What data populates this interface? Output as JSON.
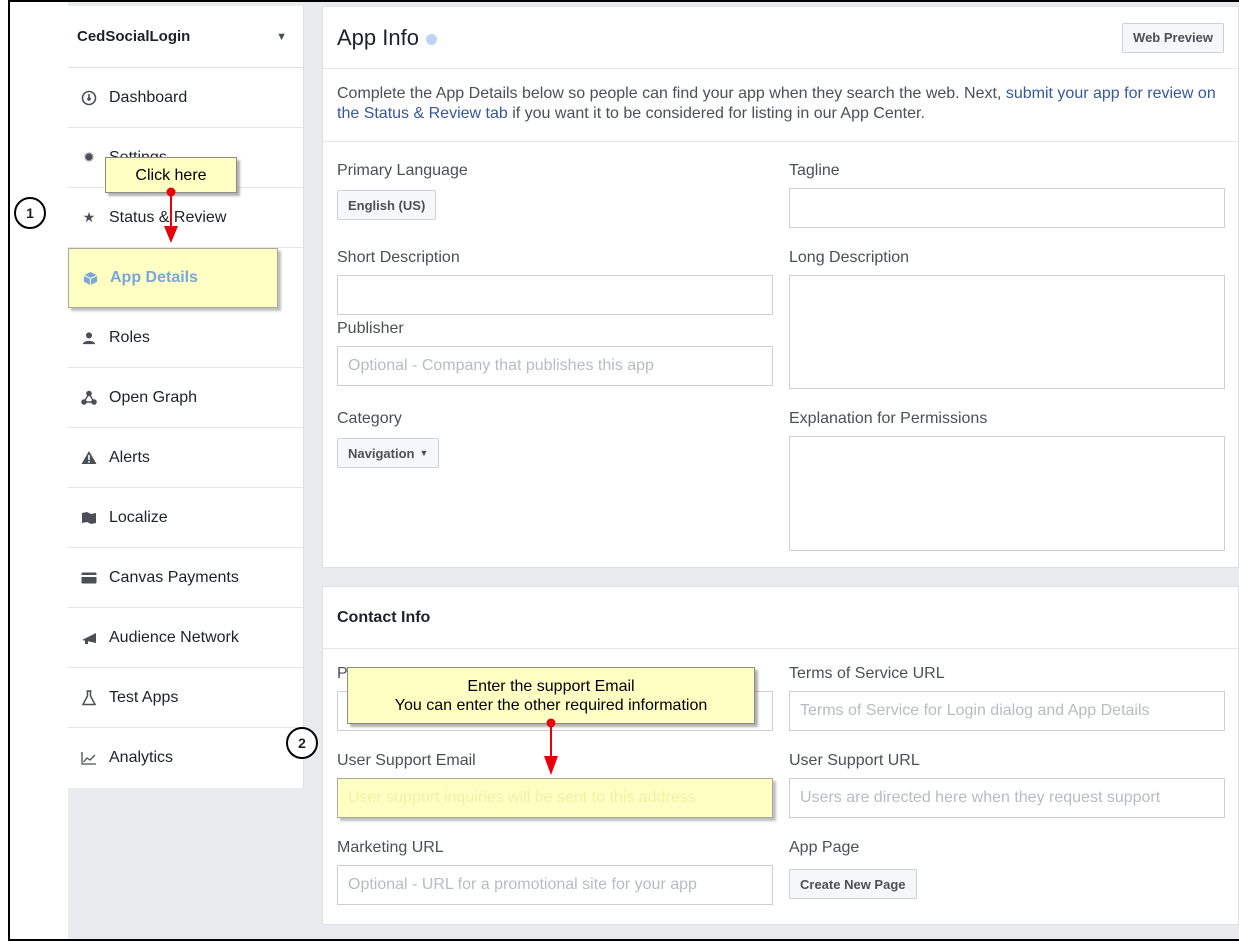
{
  "sidebar": {
    "app_name": "CedSocialLogin",
    "items": [
      {
        "label": "Dashboard",
        "icon": "dashboard-icon"
      },
      {
        "label": "Settings",
        "icon": "gear-icon"
      },
      {
        "label": "Status & Review",
        "icon": "star-icon"
      },
      {
        "label": "App Details",
        "icon": "cube-icon"
      },
      {
        "label": "Roles",
        "icon": "person-icon"
      },
      {
        "label": "Open Graph",
        "icon": "graph-nodes-icon"
      },
      {
        "label": "Alerts",
        "icon": "warning-icon"
      },
      {
        "label": "Localize",
        "icon": "flag-icon"
      },
      {
        "label": "Canvas Payments",
        "icon": "card-icon"
      },
      {
        "label": "Audience Network",
        "icon": "megaphone-icon"
      },
      {
        "label": "Test Apps",
        "icon": "flask-icon"
      },
      {
        "label": "Analytics",
        "icon": "chart-icon"
      }
    ]
  },
  "app_info": {
    "title": "App Info",
    "web_preview_label": "Web Preview",
    "intro_text": "Complete the App Details below so people can find your app when they search the web. Next, ",
    "intro_link": "submit your app for review on the Status & Review tab",
    "intro_tail": " if you want it to be considered for listing in our App Center.",
    "primary_language_label": "Primary Language",
    "primary_language_value": "English (US)",
    "tagline_label": "Tagline",
    "short_description_label": "Short Description",
    "long_description_label": "Long Description",
    "publisher_label": "Publisher",
    "publisher_placeholder": "Optional - Company that publishes this app",
    "category_label": "Category",
    "category_value": "Navigation",
    "explanation_label": "Explanation for Permissions"
  },
  "contact_info": {
    "title": "Contact Info",
    "privacy_label_partial": "P",
    "tos_label": "Terms of Service URL",
    "tos_placeholder": "Terms of Service for Login dialog and App Details",
    "support_email_label": "User Support Email",
    "support_email_placeholder": "User support inquiries will be sent to this address",
    "support_url_label": "User Support URL",
    "support_url_placeholder": "Users are directed here when they request support",
    "marketing_url_label": "Marketing URL",
    "marketing_url_placeholder": "Optional - URL for a promotional site for your app",
    "app_page_label": "App Page",
    "create_page_label": "Create New Page"
  },
  "annotations": {
    "step1": "1",
    "step2": "2",
    "callout1": "Click here",
    "callout2_line1": "Enter the support Email",
    "callout2_line2": "You can enter the other required information",
    "highlight_color": "#ffffc4",
    "arrow_color": "#e8000b"
  }
}
